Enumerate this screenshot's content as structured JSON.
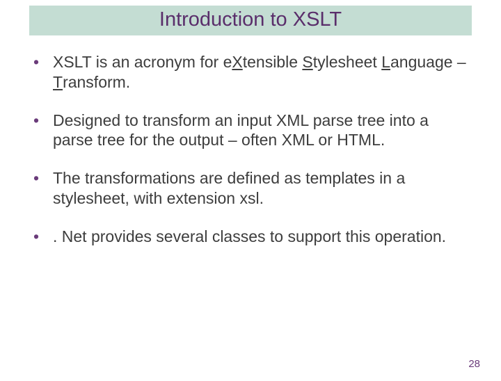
{
  "title": "Introduction to XSLT",
  "bullets": [
    {
      "pre": "XSLT is an acronym for e",
      "u1": "X",
      "mid1": "tensible ",
      "u2": "S",
      "mid2": "tylesheet ",
      "u3": "L",
      "mid3": "anguage – ",
      "u4": "T",
      "post": "ransform."
    },
    {
      "text": "Designed to transform an input XML parse tree into a parse tree for the output – often XML or HTML."
    },
    {
      "text": "The transformations are defined as templates in a stylesheet, with extension xsl."
    },
    {
      "text": ". Net provides several classes to support this operation."
    }
  ],
  "page_number": "28"
}
